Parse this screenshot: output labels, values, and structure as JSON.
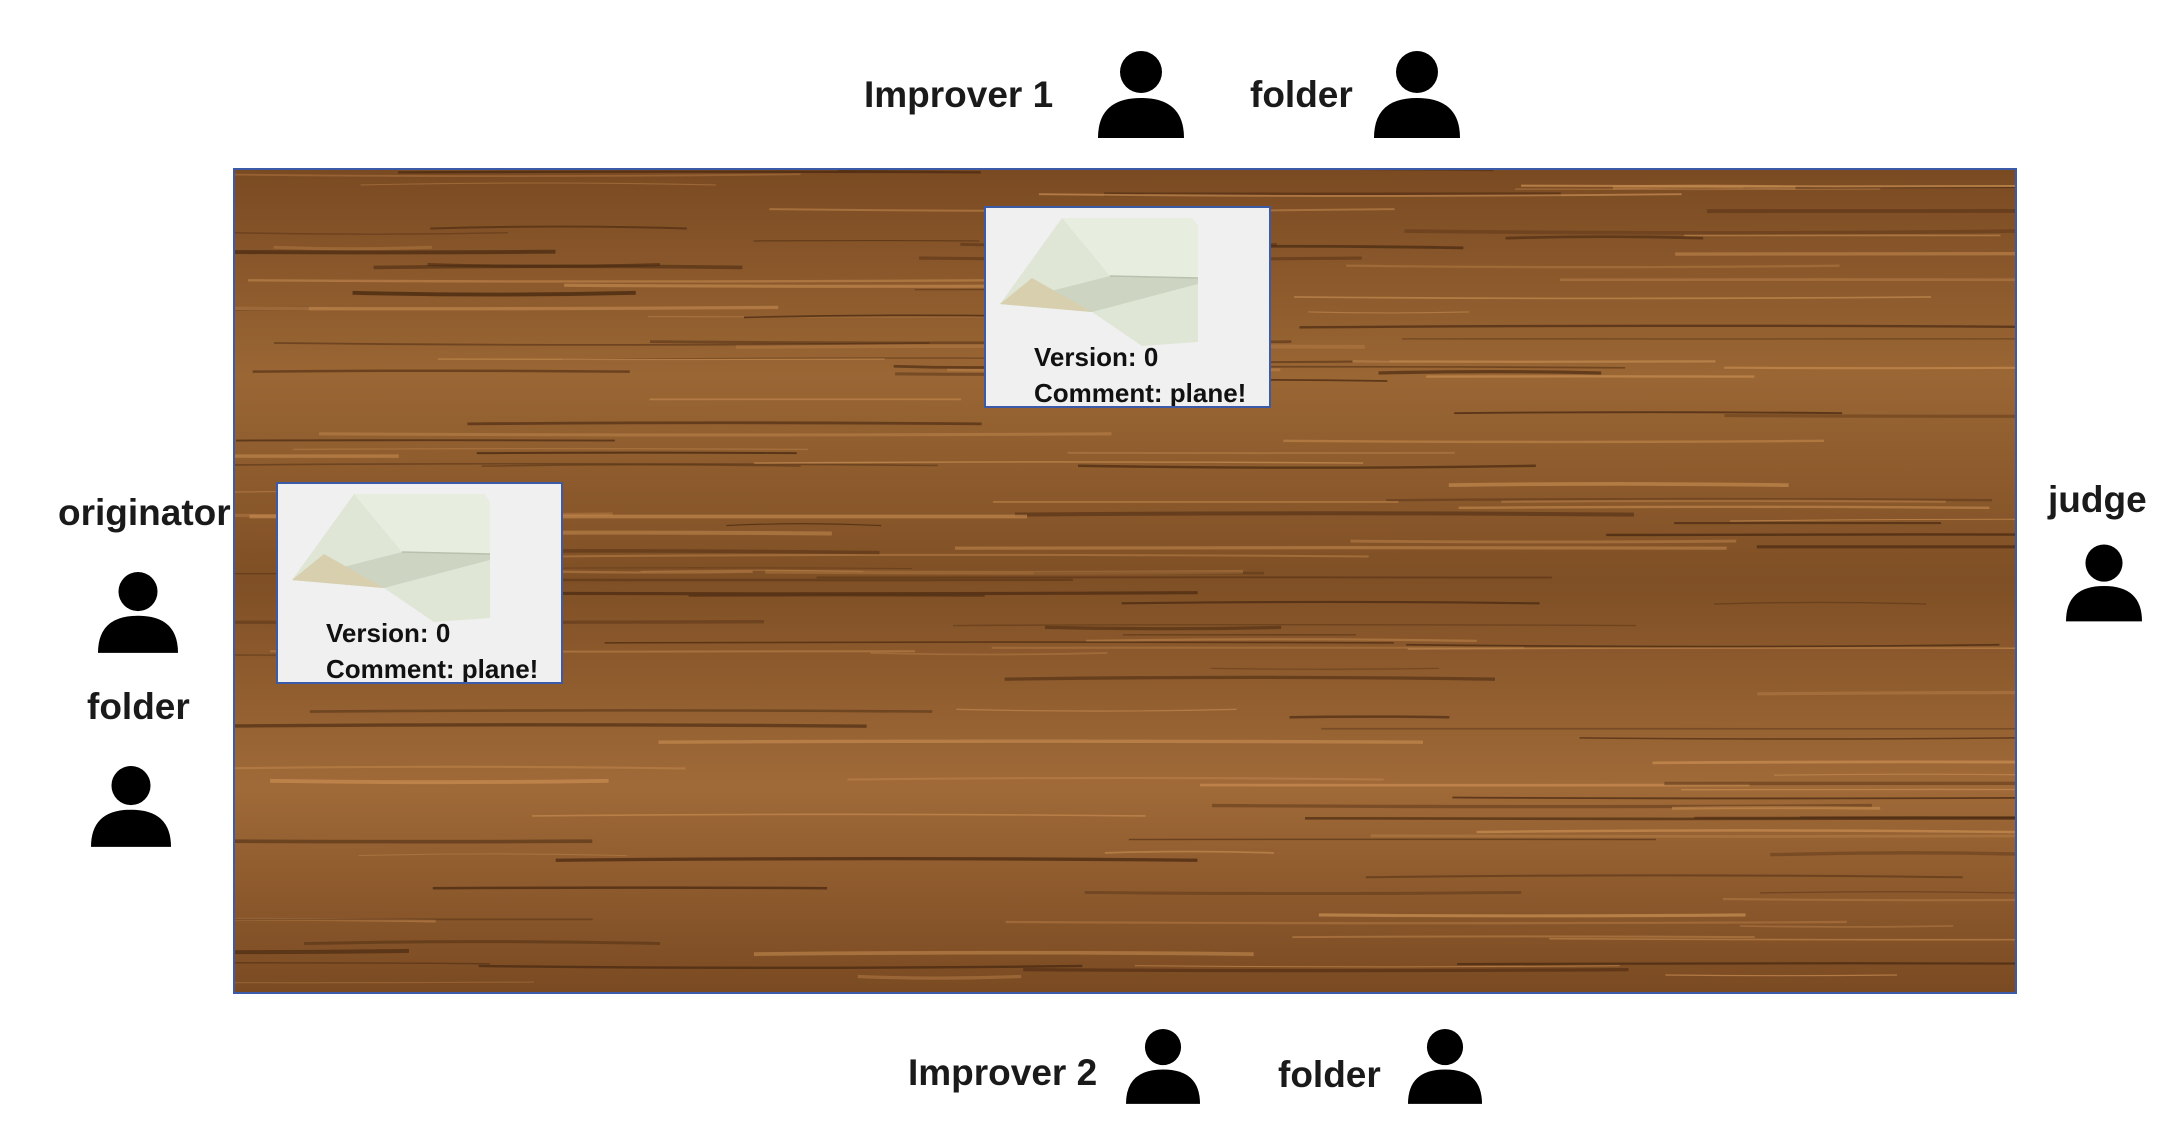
{
  "roles": {
    "improver1": "Improver 1",
    "folder_top": "folder",
    "originator": "originator",
    "folder_left": "folder",
    "judge": "judge",
    "improver2": "Improver 2",
    "folder_bottom": "folder"
  },
  "cards": [
    {
      "version": "Version: 0",
      "comment": "Comment: plane!"
    },
    {
      "version": "Version: 0",
      "comment": "Comment: plane!"
    }
  ],
  "colors": {
    "border": "#3b5aa8",
    "wood_base": "#8a5a2b",
    "person": "#000000"
  }
}
